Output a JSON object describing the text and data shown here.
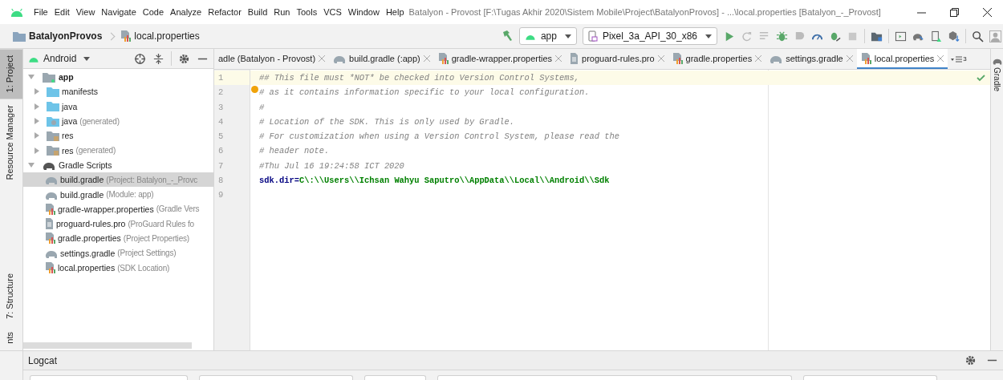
{
  "menu": [
    "File",
    "Edit",
    "View",
    "Navigate",
    "Code",
    "Analyze",
    "Refactor",
    "Build",
    "Run",
    "Tools",
    "VCS",
    "Window",
    "Help"
  ],
  "window": {
    "title": "Batalyon - Provost [F:\\Tugas Akhir 2020\\Sistem Mobile\\Project\\BatalyonProvos] - ...\\local.properties [Batalyon_-_Provost]"
  },
  "breadcrumb": [
    {
      "label": "BatalyonProvos",
      "kind": "project"
    },
    {
      "label": "local.properties",
      "kind": "properties"
    }
  ],
  "run_config": "app",
  "device": "Pixel_3a_API_30_x86",
  "left_stripe": [
    {
      "label": "1: Project",
      "selected": true
    },
    {
      "label": "Resource Manager",
      "selected": false
    }
  ],
  "left_stripe_bottom": [
    {
      "label": "7: Structure",
      "selected": false
    },
    {
      "label": "nts",
      "selected": false
    }
  ],
  "project_view": "Android",
  "tree": [
    {
      "label": "app",
      "kind": "module",
      "expanded": true,
      "selected": false,
      "children": [
        {
          "label": "manifests",
          "kind": "folder",
          "expanded": false,
          "selected": false
        },
        {
          "label": "java",
          "kind": "folder",
          "expanded": false,
          "selected": false
        },
        {
          "label": "java",
          "detail": "(generated)",
          "kind": "genfolder",
          "expanded": false,
          "selected": false
        },
        {
          "label": "res",
          "kind": "resfolder",
          "expanded": false,
          "selected": false
        },
        {
          "label": "res",
          "detail": "(generated)",
          "kind": "resfolder",
          "expanded": false,
          "selected": false
        }
      ]
    },
    {
      "label": "Gradle Scripts",
      "kind": "gradle",
      "expanded": true,
      "selected": false,
      "children": [
        {
          "label": "build.gradle",
          "detail": "(Project: Batalyon_-_Provc",
          "kind": "gradle",
          "selected": true
        },
        {
          "label": "build.gradle",
          "detail": "(Module: app)",
          "kind": "gradle",
          "selected": false
        },
        {
          "label": "gradle-wrapper.properties",
          "detail": "(Gradle Vers",
          "kind": "properties",
          "selected": false
        },
        {
          "label": "proguard-rules.pro",
          "detail": "(ProGuard Rules fo",
          "kind": "text",
          "selected": false
        },
        {
          "label": "gradle.properties",
          "detail": "(Project Properties)",
          "kind": "properties",
          "selected": false
        },
        {
          "label": "settings.gradle",
          "detail": "(Project Settings)",
          "kind": "gradle",
          "selected": false
        },
        {
          "label": "local.properties",
          "detail": "(SDK Location)",
          "kind": "properties",
          "selected": false
        }
      ]
    }
  ],
  "tabs": [
    {
      "label": "adle (Batalyon - Provost)",
      "kind": "plain",
      "selected": false
    },
    {
      "label": "build.gradle (:app)",
      "kind": "gradle",
      "selected": false
    },
    {
      "label": "gradle-wrapper.properties",
      "kind": "properties",
      "selected": false
    },
    {
      "label": "proguard-rules.pro",
      "kind": "text",
      "selected": false
    },
    {
      "label": "gradle.properties",
      "kind": "properties",
      "selected": false
    },
    {
      "label": "settings.gradle",
      "kind": "gradle",
      "selected": false
    },
    {
      "label": "local.properties",
      "kind": "properties",
      "selected": true
    }
  ],
  "tab_overflow": "3",
  "code": [
    {
      "number": "1",
      "current": true,
      "segments": [
        {
          "text": "## This file must *NOT* be checked into Version Control Systems,",
          "kind": "comment"
        }
      ]
    },
    {
      "number": "2",
      "current": false,
      "segments": [
        {
          "text": "# as it contains information specific to your local configuration.",
          "kind": "comment"
        }
      ]
    },
    {
      "number": "3",
      "current": false,
      "segments": [
        {
          "text": "#",
          "kind": "comment"
        }
      ]
    },
    {
      "number": "4",
      "current": false,
      "segments": [
        {
          "text": "# Location of the SDK. This is only used by Gradle.",
          "kind": "comment"
        }
      ]
    },
    {
      "number": "5",
      "current": false,
      "segments": [
        {
          "text": "# For customization when using a Version Control System, please read the",
          "kind": "comment"
        }
      ]
    },
    {
      "number": "6",
      "current": false,
      "segments": [
        {
          "text": "# header note.",
          "kind": "comment"
        }
      ]
    },
    {
      "number": "7",
      "current": false,
      "segments": [
        {
          "text": "#Thu Jul 16 19:24:58 ICT 2020",
          "kind": "comment"
        }
      ]
    },
    {
      "number": "8",
      "current": false,
      "segments": [
        {
          "text": "sdk.dir",
          "kind": "key"
        },
        {
          "text": "=",
          "kind": "sep"
        },
        {
          "text": "C\\:\\\\Users\\\\Ichsan Wahyu Saputro\\\\AppData\\\\Local\\\\Android\\\\Sdk",
          "kind": "value"
        }
      ]
    },
    {
      "number": "9",
      "current": false
    }
  ],
  "right_stripe": [
    {
      "label": "Gradle",
      "selected": false
    }
  ],
  "bottom_panel": {
    "title": "Logcat"
  }
}
